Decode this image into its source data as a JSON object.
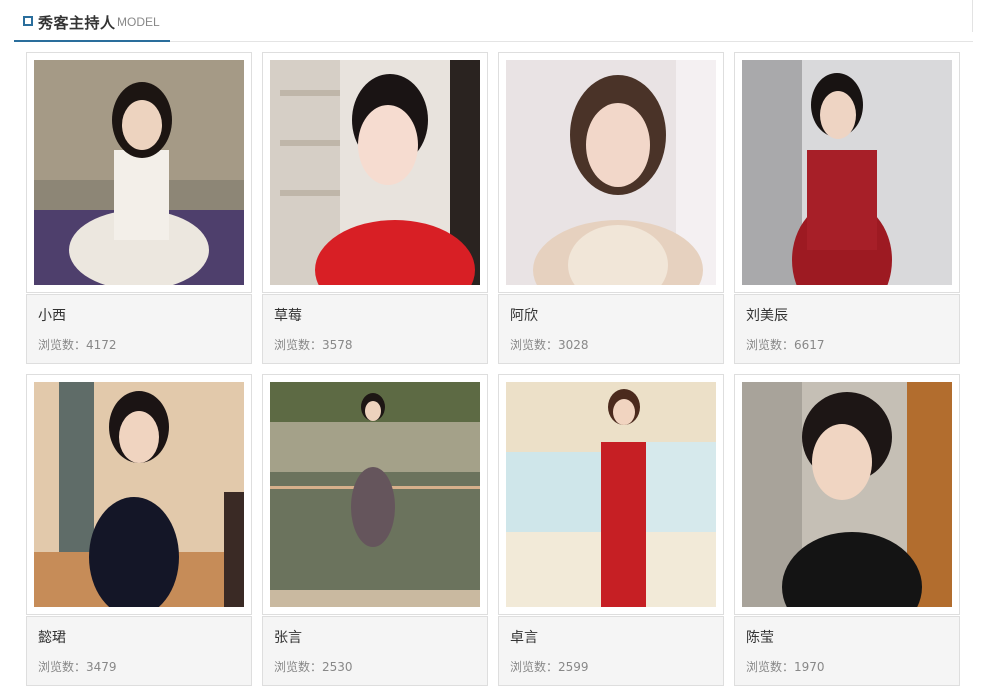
{
  "section": {
    "title": "秀客主持人",
    "subtitle": "MODEL",
    "accent_color": "#2a6e9c",
    "icon": "square-icon"
  },
  "views_label": "浏览数：",
  "models": [
    {
      "name": "小西",
      "views": "4172"
    },
    {
      "name": "草莓",
      "views": "3578"
    },
    {
      "name": "阿欣",
      "views": "3028"
    },
    {
      "name": "刘美辰",
      "views": "6617"
    },
    {
      "name": "懿珺",
      "views": "3479"
    },
    {
      "name": "张言",
      "views": "2530"
    },
    {
      "name": "卓言",
      "views": "2599"
    },
    {
      "name": "陈莹",
      "views": "1970"
    }
  ]
}
